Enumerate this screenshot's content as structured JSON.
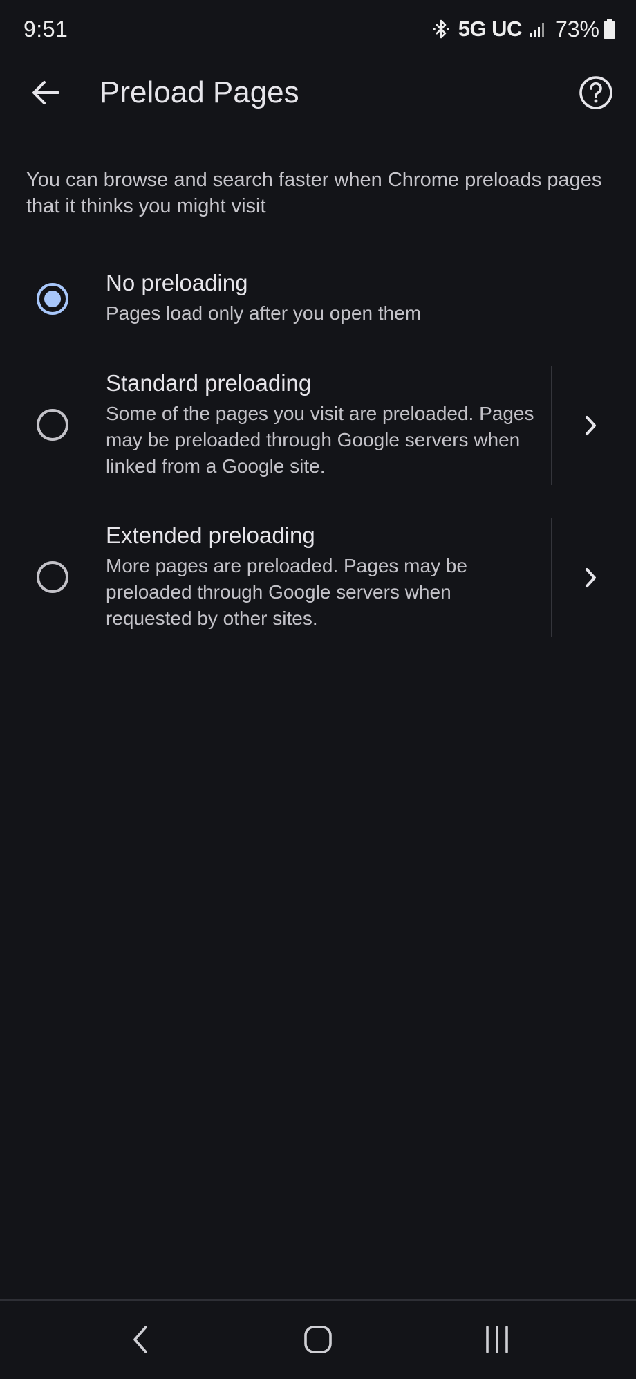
{
  "status_bar": {
    "time": "9:51",
    "network": "5G UC",
    "battery": "73%",
    "icons": [
      "bluetooth-icon",
      "signal-icon",
      "battery-icon"
    ]
  },
  "app_bar": {
    "title": "Preload Pages",
    "back_icon": "arrow-back-icon",
    "help_icon": "help-circle-icon"
  },
  "description": "You can browse and search faster when Chrome preloads pages that it thinks you might visit",
  "options": [
    {
      "title": "No preloading",
      "description": "Pages load only after you open them",
      "selected": true,
      "has_details": false
    },
    {
      "title": "Standard preloading",
      "description": "Some of the pages you visit are preloaded. Pages may be preloaded through Google servers when linked from a Google site.",
      "selected": false,
      "has_details": true
    },
    {
      "title": "Extended preloading",
      "description": "More pages are preloaded. Pages may be preloaded through Google servers when requested by other sites.",
      "selected": false,
      "has_details": true
    }
  ],
  "colors": {
    "background": "#131418",
    "accent": "#a8c7fa",
    "text_primary": "#e6e5ea",
    "text_secondary": "#c3c2c8"
  },
  "nav_bar": {
    "buttons": [
      "nav-back-icon",
      "nav-home-icon",
      "nav-recents-icon"
    ]
  }
}
